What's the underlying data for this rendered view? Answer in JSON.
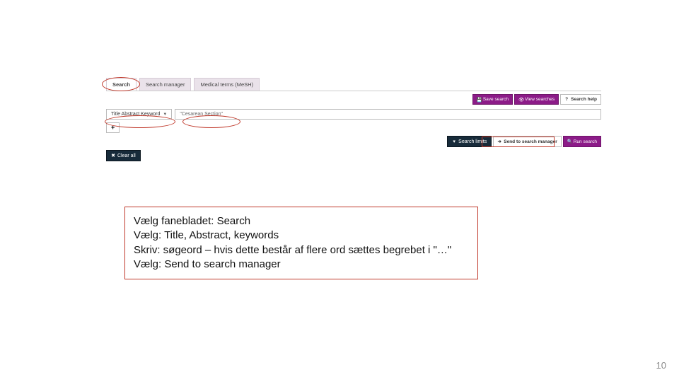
{
  "tabs": {
    "search": "Search",
    "manager": "Search manager",
    "mesh": "Medical terms (MeSH)"
  },
  "toolbar": {
    "save_search": "Save search",
    "view_searches": "View searches",
    "search_help": "Search help"
  },
  "filter": {
    "dropdown_label": "Title Abstract Keyword",
    "input_value": "\"Cesarean Section\""
  },
  "actions": {
    "search_limits": "Search limits",
    "send_to_manager": "Send to search manager",
    "run_search": "Run search",
    "clear_all": "Clear all"
  },
  "instructions": {
    "l1": "Vælg fanebladet: Search",
    "l2": "Vælg: Title, Abstract, keywords",
    "l3": "Skriv: søgeord – hvis dette består af flere ord sættes begrebet i \"…\"",
    "l4": "Vælg: Send to search manager"
  },
  "page_number": "10"
}
